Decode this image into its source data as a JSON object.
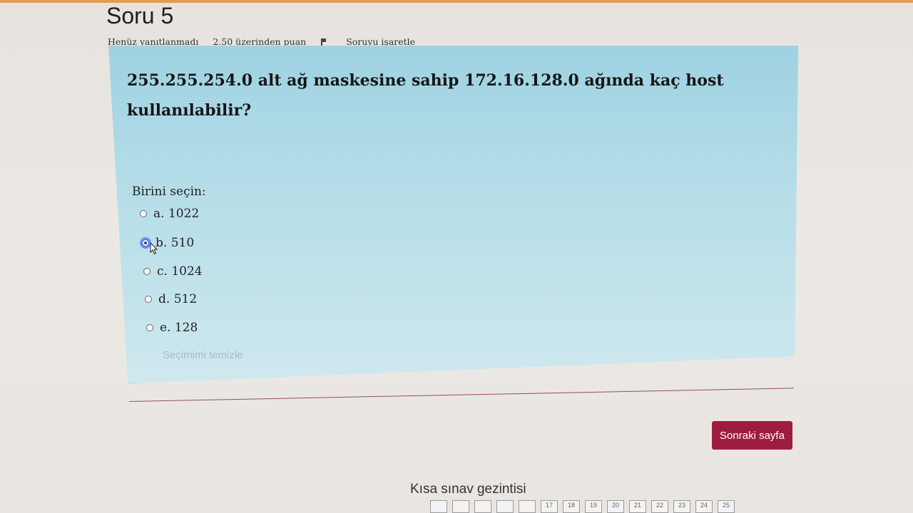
{
  "header": {
    "title": "Soru 5"
  },
  "meta": {
    "status": "Henüz yanıtlanmadı",
    "points": "2.50 üzerinden puan",
    "flag_label": "Soruyu işaretle"
  },
  "question": {
    "text": "255.255.254.0 alt ağ maskesine sahip 172.16.128.0 ağında kaç host kullanılabilir?",
    "prompt": "Birini seçin:",
    "options": [
      {
        "label": "a. 1022",
        "selected": false
      },
      {
        "label": "b. 510",
        "selected": true
      },
      {
        "label": "c. 1024",
        "selected": false
      },
      {
        "label": "d. 512",
        "selected": false
      },
      {
        "label": "e. 128",
        "selected": false
      }
    ],
    "clear_label": "Seçimimi temizle"
  },
  "footer": {
    "next_label": "Sonraki sayfa",
    "nav_title": "Kısa sınav gezintisi",
    "nav_pages": [
      "",
      "",
      "",
      "",
      "",
      "17",
      "18",
      "19",
      "20",
      "21",
      "22",
      "23",
      "24",
      "25"
    ]
  },
  "colors": {
    "accent": "#9e1d3f",
    "question_bg": "#b6dee9",
    "top_bar": "#e39b58"
  },
  "icons": {
    "flag": "flag-icon",
    "cursor": "mouse-pointer-icon"
  }
}
